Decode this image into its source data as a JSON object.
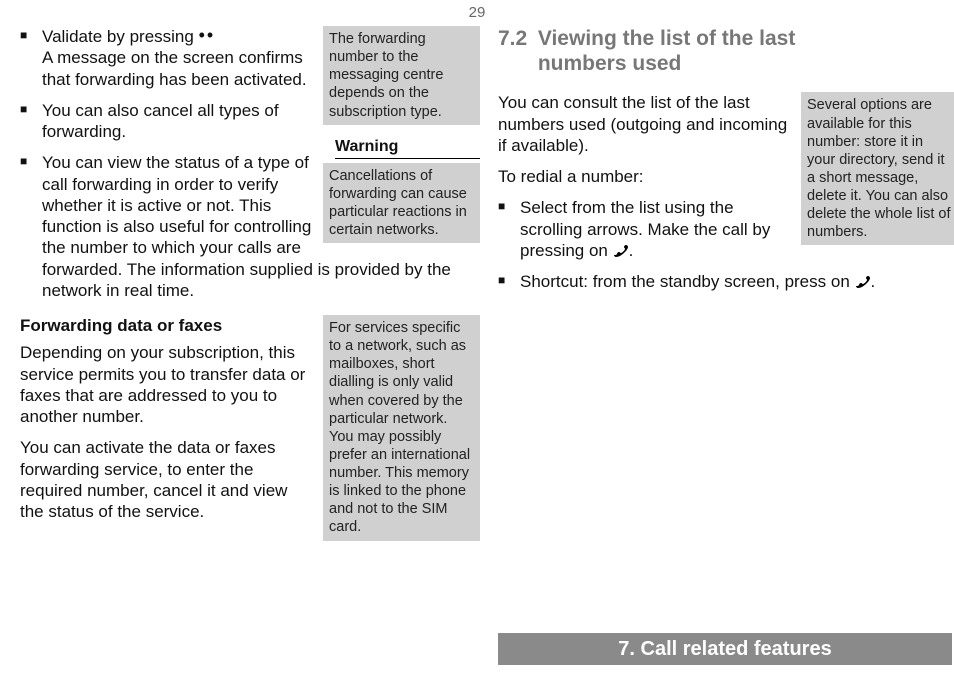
{
  "page_number": "29",
  "left": {
    "bullets": [
      {
        "lead": "Validate by pressing ",
        "tail": "A message on the screen confirms that forwarding has been activated."
      },
      {
        "text": "You can also cancel all types of forwarding."
      },
      {
        "text": "You can view the status of a type of call forwarding in order to verify whether it is active or not. This function is also useful for controlling the number to which your calls are forwarded. The information supplied is provided by the network in real time."
      }
    ],
    "note1": "The forwarding number to the messaging centre depends on the subscription type.",
    "warning_label": "Warning",
    "note2": "Cancellations of forwarding can cause particular reactions in certain networks.",
    "subhead": "Forwarding data or faxes",
    "para1": "Depending on your subscription, this service permits you to transfer data or faxes that are addressed to you to another number.",
    "para2": "You can activate the data or faxes forwarding service, to enter the required number, cancel it and view the status of the service.",
    "note3": "For services specific to a network, such as mailboxes, short dialling is only valid when covered by the particular network. You may possibly prefer an international number. This memory is linked to the phone and not to the SIM card."
  },
  "right": {
    "section_number": "7.2",
    "section_title": "Viewing the list of the last numbers used",
    "intro": "You can consult the list of the last numbers used (outgoing and incoming if available).",
    "lead": "To redial a number:",
    "bullets": [
      {
        "pre": "Select from the list using the scrolling arrows. Make the call by pressing on ",
        "post": "."
      },
      {
        "pre": "Shortcut: from the standby screen, press on ",
        "post": "."
      }
    ],
    "note": "Several options are available for this number: store it in your directory, send it a short message, delete it. You can also delete the whole list of numbers."
  },
  "footer": "7. Call related features"
}
